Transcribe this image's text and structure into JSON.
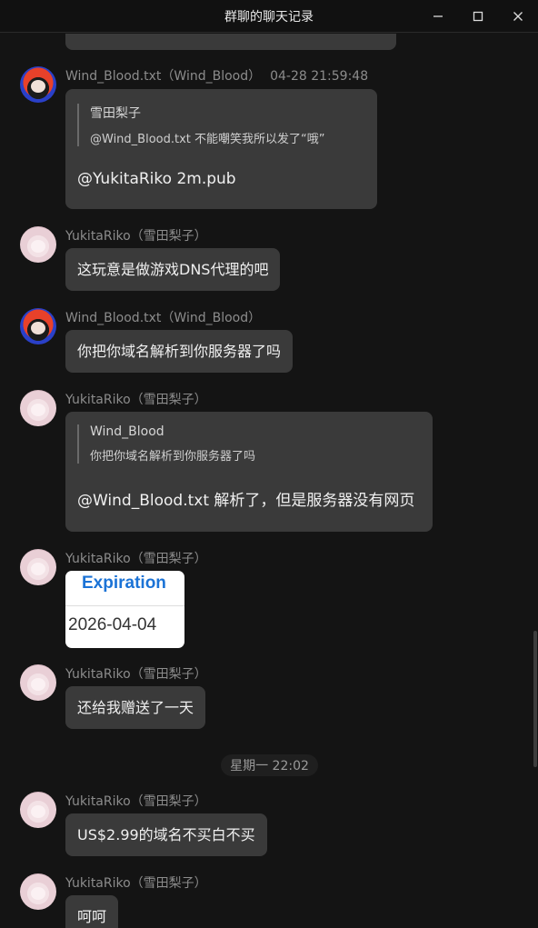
{
  "window": {
    "title": "群聊的聊天记录",
    "controls": {
      "minimize": "minimize-icon",
      "maximize": "maximize-icon",
      "close": "close-icon"
    }
  },
  "messages": [
    {
      "sender": "Wind_Blood.txt（Wind_Blood）",
      "time": "04-28 21:59:48",
      "quote": {
        "name": "雪田梨子",
        "text": "@Wind_Blood.txt 不能嘲笑我所以发了“哦”"
      },
      "text": "@YukitaRiko 2m.pub"
    },
    {
      "sender": "YukitaRiko（雪田梨子）",
      "text": "这玩意是做游戏DNS代理的吧"
    },
    {
      "sender": "Wind_Blood.txt（Wind_Blood）",
      "text": "你把你域名解析到你服务器了吗"
    },
    {
      "sender": "YukitaRiko（雪田梨子）",
      "quote": {
        "name": "Wind_Blood",
        "text": "你把你域名解析到你服务器了吗"
      },
      "text": "@Wind_Blood.txt 解析了，但是服务器没有网页"
    },
    {
      "sender": "YukitaRiko（雪田梨子）",
      "image": {
        "heading": "Expiration",
        "value": "2026-04-04"
      }
    },
    {
      "sender": "YukitaRiko（雪田梨子）",
      "text": "还给我赠送了一天"
    },
    {
      "sender": "YukitaRiko（雪田梨子）",
      "text": "US$2.99的域名不买白不买"
    },
    {
      "sender": "YukitaRiko（雪田梨子）",
      "text": "呵呵"
    }
  ],
  "time_divider": "星期一 22:02",
  "colors": {
    "background": "#141414",
    "bubble": "#3a3a3a",
    "sender_text": "#8c8c8c",
    "link_blue": "#1b73d6"
  }
}
